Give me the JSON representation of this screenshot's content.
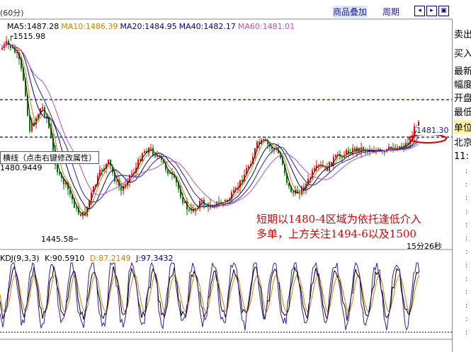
{
  "toolbar": {
    "period": "(60分)",
    "overlay_button": "商品叠加",
    "cycle_button": "周期"
  },
  "ma_legend": [
    {
      "text": "MA5:1487.28",
      "color": "#000000"
    },
    {
      "text": "MA10:1486.39",
      "color": "#d28000"
    },
    {
      "text": "MA20:1484.95",
      "color": "#000080"
    },
    {
      "text": "MA40:1482.17",
      "color": "#000080"
    },
    {
      "text": "MA60:1481.01",
      "color": "#c050c0"
    }
  ],
  "chart": {
    "high_label": "1515.98",
    "low_label": "1445.58",
    "hline_label": "横线（点击右键修改属性）",
    "hline_value": "1480.9449",
    "right_price": "1481.30",
    "annotation_line1": "短期以1480-4区域为依托逢低介入",
    "annotation_line2": "多单，上方关注1494-6以及1500",
    "timer": "15分26秒",
    "up_color": "#ff0000",
    "down_color": "#008000",
    "dash_color": "#0000a0"
  },
  "kdj": {
    "title": "KDJ(9,3,3)",
    "k": "K:90.5910",
    "d": "D:87.2149",
    "j": "J:97.3432"
  },
  "right_panel": [
    {
      "label": "卖出"
    },
    {
      "label": "买入"
    },
    {
      "label": "最新"
    },
    {
      "label": "幅度"
    },
    {
      "label": "开盘"
    },
    {
      "label": "最低"
    },
    {
      "label": "单位"
    },
    {
      "label": "北京"
    },
    {
      "label": "11:"
    }
  ]
}
